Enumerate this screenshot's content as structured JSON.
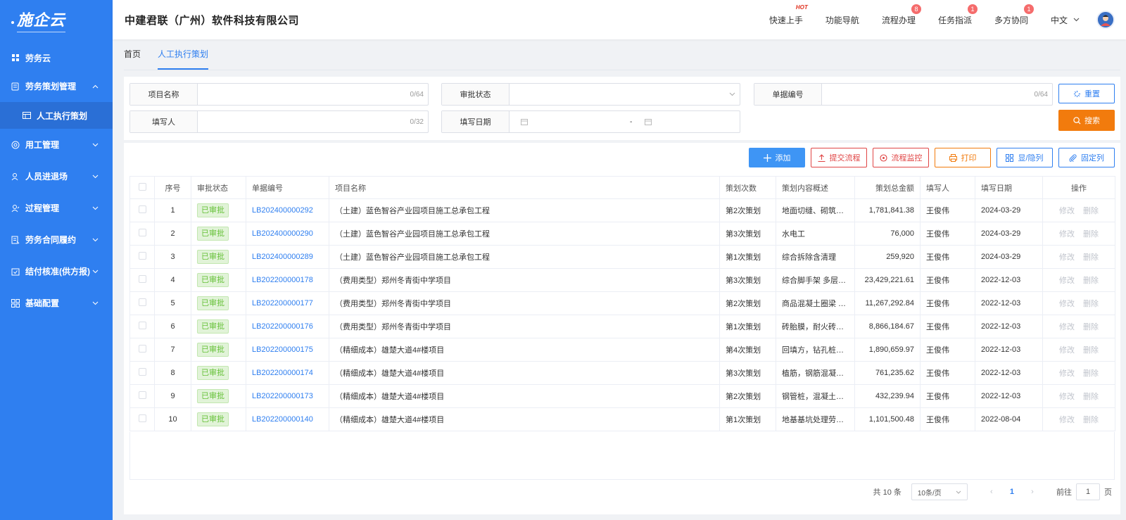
{
  "brand": {
    "logo": "施企云"
  },
  "sidebar": {
    "items": [
      {
        "label": "劳务云",
        "icon": "grid-icon",
        "expandable": false
      },
      {
        "label": "劳务策划管理",
        "icon": "ledger-icon",
        "expandable": true,
        "expanded": true
      },
      {
        "label": "人工执行策划",
        "icon": "table-icon",
        "sub": true
      },
      {
        "label": "用工管理",
        "icon": "badge-icon",
        "expandable": true
      },
      {
        "label": "人员进退场",
        "icon": "user-icon",
        "expandable": true
      },
      {
        "label": "过程管理",
        "icon": "user-edit-icon",
        "expandable": true
      },
      {
        "label": "劳务合同履约",
        "icon": "contract-icon",
        "expandable": true
      },
      {
        "label": "结付核准(供方报)",
        "icon": "check-calendar-icon",
        "expandable": true
      },
      {
        "label": "基础配置",
        "icon": "apps-icon",
        "expandable": true
      }
    ]
  },
  "header": {
    "company": "中建君联（广州）软件科技有限公司",
    "nav": [
      {
        "label": "快速上手",
        "badge": "",
        "hot": "HOT"
      },
      {
        "label": "功能导航",
        "badge": ""
      },
      {
        "label": "流程办理",
        "badge": "8"
      },
      {
        "label": "任务指派",
        "badge": "1"
      },
      {
        "label": "多方协同",
        "badge": "1"
      }
    ],
    "language": "中文"
  },
  "tabs": [
    {
      "label": "首页",
      "active": false
    },
    {
      "label": "人工执行策划",
      "active": true
    }
  ],
  "filters": {
    "project_name": {
      "label": "项目名称",
      "count": "0/64"
    },
    "approval_status": {
      "label": "审批状态"
    },
    "doc_no": {
      "label": "单据编号",
      "count": "0/64"
    },
    "filler": {
      "label": "填写人",
      "count": "0/32"
    },
    "fill_date": {
      "label": "填写日期",
      "separator": "-"
    },
    "reset": "重置",
    "search": "搜索"
  },
  "toolbar": {
    "add": "添加",
    "submit_flow": "提交流程",
    "monitor_flow": "流程监控",
    "print": "打印",
    "toggle_cols": "显/隐列",
    "fixed_cols": "固定列"
  },
  "table": {
    "columns": [
      "序号",
      "审批状态",
      "单据编号",
      "项目名称",
      "策划次数",
      "策划内容概述",
      "策划总金额",
      "填写人",
      "填写日期",
      "操作"
    ],
    "rows": [
      {
        "no": "1",
        "status": "已审批",
        "doc": "LB202400000292",
        "project": "（土建）蓝色智谷产业园项目施工总承包工程",
        "times": "第2次策划",
        "summary": "地面切缝、砌筑…",
        "amount": "1,781,841.38",
        "filler": "王俊伟",
        "date": "2024-03-29"
      },
      {
        "no": "2",
        "status": "已审批",
        "doc": "LB202400000290",
        "project": "（土建）蓝色智谷产业园项目施工总承包工程",
        "times": "第3次策划",
        "summary": "水电工",
        "amount": "76,000",
        "filler": "王俊伟",
        "date": "2024-03-29"
      },
      {
        "no": "3",
        "status": "已审批",
        "doc": "LB202400000289",
        "project": "（土建）蓝色智谷产业园项目施工总承包工程",
        "times": "第1次策划",
        "summary": "综合拆除含清理",
        "amount": "259,920",
        "filler": "王俊伟",
        "date": "2024-03-29"
      },
      {
        "no": "4",
        "status": "已审批",
        "doc": "LB202200000178",
        "project": "（费用类型）郑州冬青街中学项目",
        "times": "第3次策划",
        "summary": "综合脚手架 多层…",
        "amount": "23,429,221.61",
        "filler": "王俊伟",
        "date": "2022-12-03"
      },
      {
        "no": "5",
        "status": "已审批",
        "doc": "LB202200000177",
        "project": "（费用类型）郑州冬青街中学项目",
        "times": "第2次策划",
        "summary": "商品混凝土圈梁 …",
        "amount": "11,267,292.84",
        "filler": "王俊伟",
        "date": "2022-12-03"
      },
      {
        "no": "6",
        "status": "已审批",
        "doc": "LB202200000176",
        "project": "（费用类型）郑州冬青街中学项目",
        "times": "第1次策划",
        "summary": "砖胎膜，耐火砖…",
        "amount": "8,866,184.67",
        "filler": "王俊伟",
        "date": "2022-12-03"
      },
      {
        "no": "7",
        "status": "已审批",
        "doc": "LB202200000175",
        "project": "（精细成本）雄楚大道4#楼项目",
        "times": "第4次策划",
        "summary": "回填方，钻孔桩…",
        "amount": "1,890,659.97",
        "filler": "王俊伟",
        "date": "2022-12-03"
      },
      {
        "no": "8",
        "status": "已审批",
        "doc": "LB202200000174",
        "project": "（精细成本）雄楚大道4#楼项目",
        "times": "第3次策划",
        "summary": "植筋，钢筋混凝…",
        "amount": "761,235.62",
        "filler": "王俊伟",
        "date": "2022-12-03"
      },
      {
        "no": "9",
        "status": "已审批",
        "doc": "LB202200000173",
        "project": "（精细成本）雄楚大道4#楼项目",
        "times": "第2次策划",
        "summary": "钢管桩，混凝土…",
        "amount": "432,239.94",
        "filler": "王俊伟",
        "date": "2022-12-03"
      },
      {
        "no": "10",
        "status": "已审批",
        "doc": "LB202200000140",
        "project": "（精细成本）雄楚大道4#楼项目",
        "times": "第1次策划",
        "summary": "地基基坑处理劳…",
        "amount": "1,101,500.48",
        "filler": "王俊伟",
        "date": "2022-08-04"
      }
    ],
    "op_edit": "修改",
    "op_delete": "删除"
  },
  "pagination": {
    "total": "共 10 条",
    "page_size": "10条/页",
    "current": "1",
    "goto_prefix": "前往",
    "goto_value": "1",
    "goto_suffix": "页"
  }
}
